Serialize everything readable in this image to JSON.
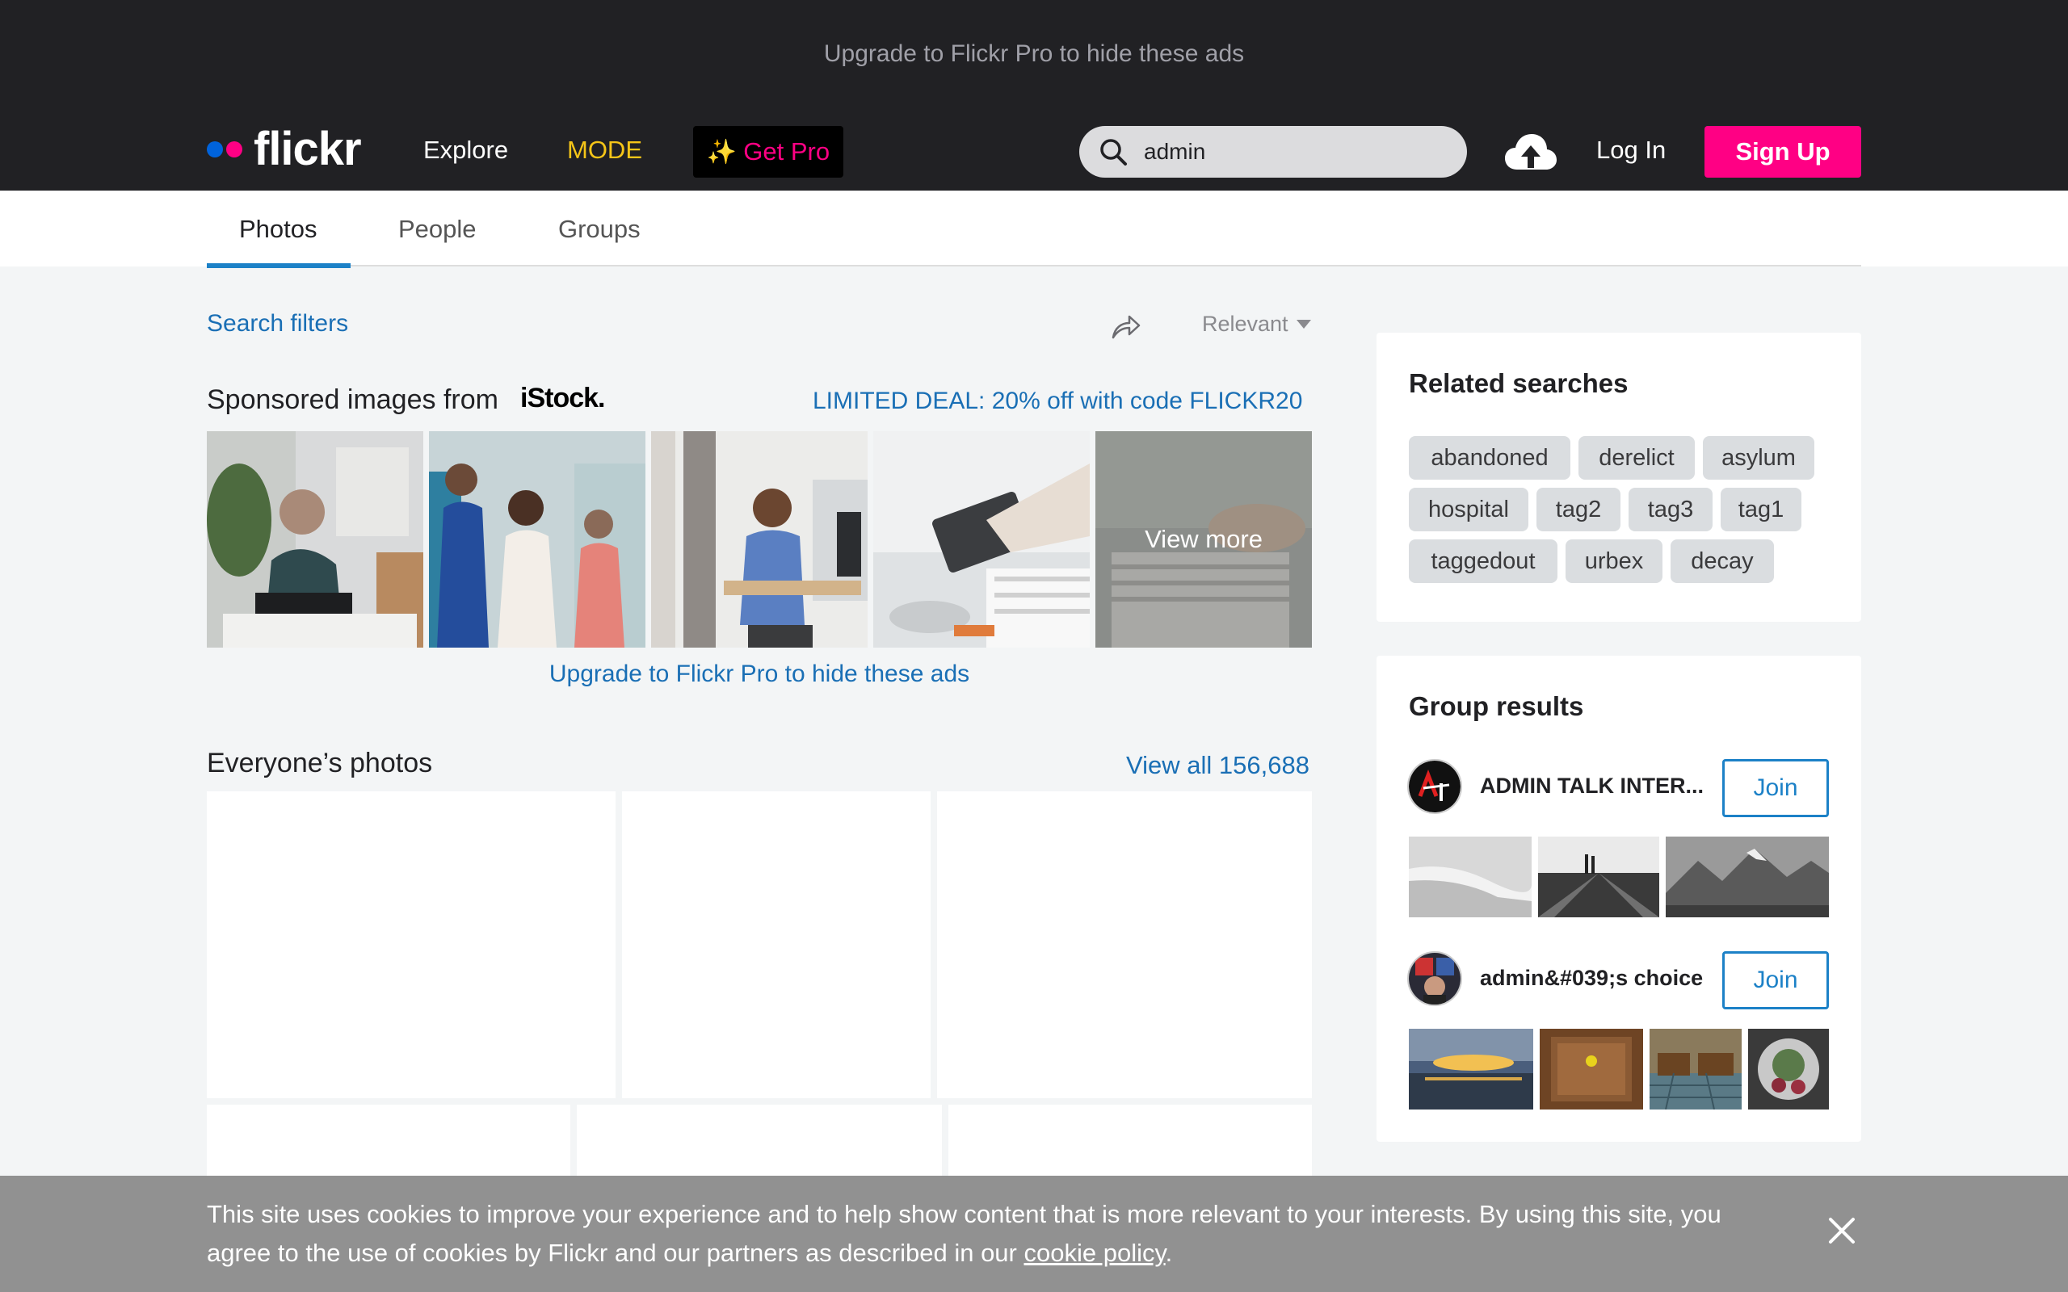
{
  "header": {
    "ad_banner": "Upgrade to Flickr Pro to hide these ads",
    "logo_text": "flickr",
    "nav": {
      "explore": "Explore",
      "mode": "MODE",
      "get_pro": "Get Pro"
    },
    "search": {
      "value": "admin",
      "placeholder": ""
    },
    "login": "Log In",
    "signup": "Sign Up"
  },
  "tabs": [
    {
      "label": "Photos",
      "active": true
    },
    {
      "label": "People",
      "active": false
    },
    {
      "label": "Groups",
      "active": false
    }
  ],
  "toolbar": {
    "search_filters": "Search filters",
    "sort": "Relevant"
  },
  "sponsored": {
    "title": "Sponsored images from",
    "brand": "iStock.",
    "deal": "LIMITED DEAL: 20% off with code FLICKR20",
    "view_more": "View more",
    "upgrade": "Upgrade to Flickr Pro to hide these ads"
  },
  "everyone": {
    "title": "Everyone’s photos",
    "view_all": "View all 156,688"
  },
  "related": {
    "title": "Related searches",
    "tags": [
      "abandoned",
      "derelict",
      "asylum",
      "hospital",
      "tag2",
      "tag3",
      "tag1",
      "taggedout",
      "urbex",
      "decay"
    ]
  },
  "groups": {
    "title": "Group results",
    "items": [
      {
        "name": "ADMIN TALK INTER...",
        "join": "Join"
      },
      {
        "name": "admin&#039;s choice",
        "join": "Join"
      }
    ]
  },
  "cookie": {
    "text_before": "This site uses cookies to improve your experience and to help show content that is more relevant to your interests. By using this site, you agree to the use of cookies by Flickr and our partners as described in our ",
    "link": "cookie policy",
    "text_after": "."
  },
  "colors": {
    "header_bg": "#212124",
    "brand_blue": "#0063dc",
    "brand_pink": "#ff0084",
    "link_blue": "#1a6fb5",
    "mode_yellow": "#f5c518"
  }
}
